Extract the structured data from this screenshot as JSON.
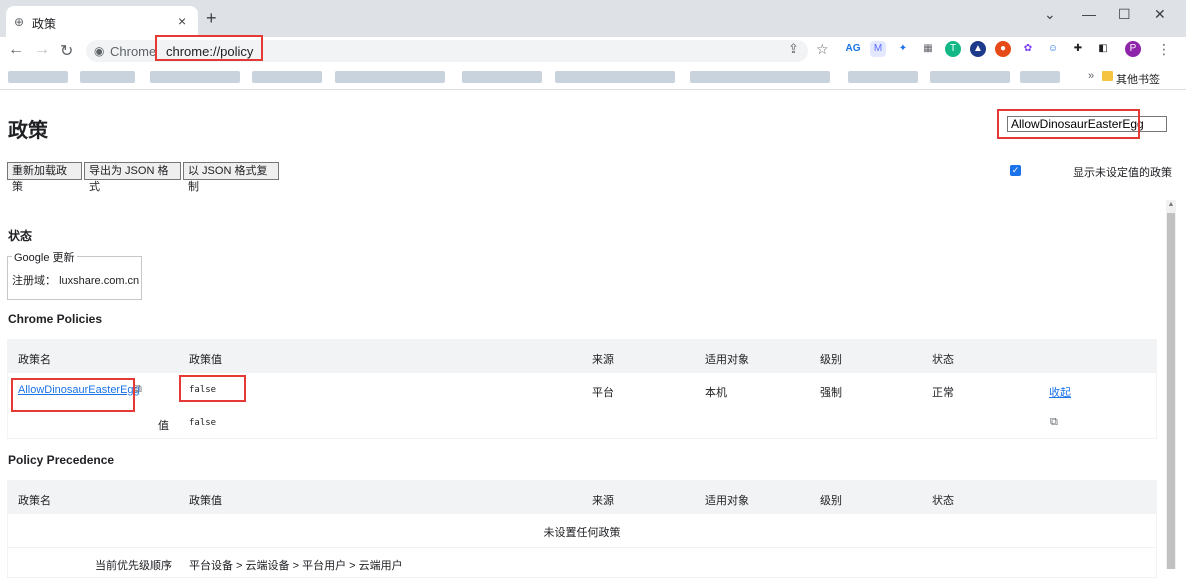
{
  "browser": {
    "tab_title": "政策",
    "omnibox_site": "Chrome",
    "url": "chrome://policy",
    "other_bookmarks": "其他书签",
    "bookmarks_more": "»",
    "profile_initial": "P",
    "extension_ag": "AG"
  },
  "page": {
    "title": "政策",
    "filter_value": "AllowDinosaurEasterEgg",
    "buttons": {
      "reload": "重新加载政策",
      "export": "导出为 JSON 格式",
      "copy": "以 JSON 格式复制"
    },
    "show_unset_label": "显示未设定值的政策",
    "show_unset_checked": true
  },
  "status": {
    "heading": "状态",
    "legend": "Google 更新",
    "domain_label": "注册域：",
    "domain_value": "luxshare.com.cn"
  },
  "chrome_policies": {
    "heading": "Chrome Policies",
    "columns": [
      "政策名",
      "政策值",
      "来源",
      "适用对象",
      "级别",
      "状态"
    ],
    "row": {
      "name": "AllowDinosaurEasterEgg",
      "value": "false",
      "source": "平台",
      "scope": "本机",
      "level": "强制",
      "status": "正常",
      "toggle": "收起",
      "detail_label": "值",
      "detail_value": "false"
    }
  },
  "policy_precedence": {
    "heading": "Policy Precedence",
    "columns": [
      "政策名",
      "政策值",
      "来源",
      "适用对象",
      "级别",
      "状态"
    ],
    "empty": "未设置任何政策",
    "order_label": "当前优先级顺序",
    "order_value": "平台设备 > 云端设备 > 平台用户 > 云端用户"
  }
}
